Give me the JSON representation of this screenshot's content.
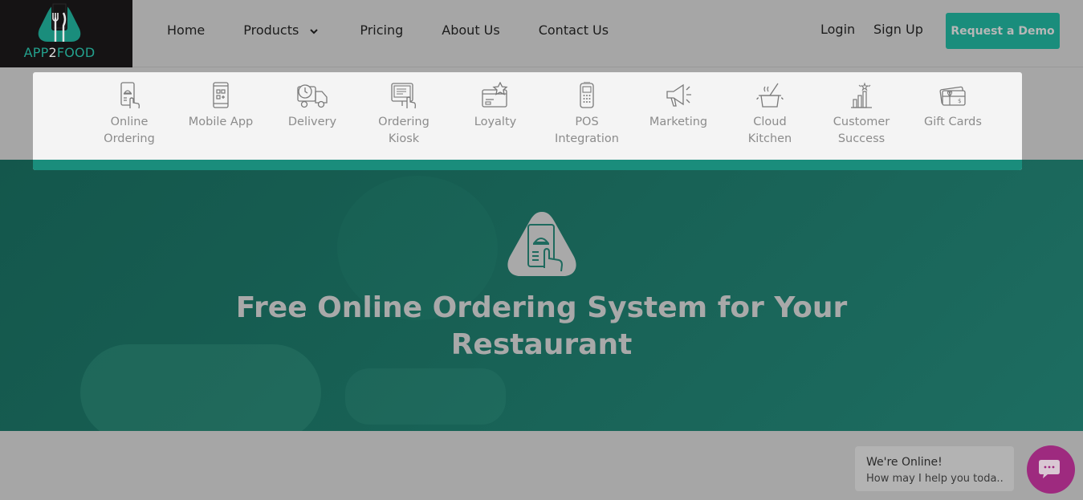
{
  "logo": {
    "prefix": "APP",
    "middle": "2",
    "suffix": "FOOD"
  },
  "nav": {
    "home": "Home",
    "products": "Products",
    "pricing": "Pricing",
    "about": "About Us",
    "contact": "Contact Us"
  },
  "auth": {
    "login": "Login",
    "signup": "Sign Up",
    "demo": "Request a Demo"
  },
  "products_menu": [
    {
      "label_1": "Online",
      "label_2": "Ordering",
      "icon": "online-ordering-icon"
    },
    {
      "label_1": "Mobile App",
      "label_2": "",
      "icon": "mobile-app-icon"
    },
    {
      "label_1": "Delivery",
      "label_2": "",
      "icon": "delivery-truck-icon"
    },
    {
      "label_1": "Ordering",
      "label_2": "Kiosk",
      "icon": "kiosk-icon"
    },
    {
      "label_1": "Loyalty",
      "label_2": "",
      "icon": "loyalty-card-icon"
    },
    {
      "label_1": "POS",
      "label_2": "Integration",
      "icon": "pos-terminal-icon"
    },
    {
      "label_1": "Marketing",
      "label_2": "",
      "icon": "megaphone-icon"
    },
    {
      "label_1": "Cloud",
      "label_2": "Kitchen",
      "icon": "cooking-pot-icon"
    },
    {
      "label_1": "Customer",
      "label_2": "Success",
      "icon": "growth-chart-icon"
    },
    {
      "label_1": "Gift Cards",
      "label_2": "",
      "icon": "gift-card-icon"
    }
  ],
  "hero": {
    "title_line1": "Free Online Ordering System for Your",
    "title_line2": "Restaurant"
  },
  "chat": {
    "status": "We're Online!",
    "prompt": "How may I help you toda..."
  },
  "colors": {
    "brand_teal": "#1a8d7c",
    "hero_teal": "#175f53",
    "chat_purple": "#9e2a7f",
    "overlay_gray": "#a6a6a6"
  }
}
